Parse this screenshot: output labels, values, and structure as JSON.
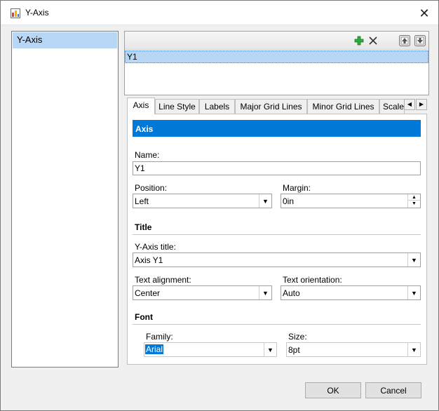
{
  "window": {
    "title": "Y-Axis",
    "close_glyph": "✕"
  },
  "nav": {
    "items": [
      "Y-Axis"
    ]
  },
  "series_list": {
    "items": [
      "Y1"
    ],
    "toolbar": [
      "add-icon",
      "delete-icon",
      "move-up-icon",
      "move-down-icon"
    ]
  },
  "tabs": [
    "Axis",
    "Line Style",
    "Labels",
    "Major Grid Lines",
    "Minor Grid Lines",
    "Scale"
  ],
  "tab_scroll": {
    "left": "◀",
    "right": "▶"
  },
  "axis_panel": {
    "header": "Axis",
    "name_label": "Name:",
    "name_value": "Y1",
    "position_label": "Position:",
    "position_value": "Left",
    "margin_label": "Margin:",
    "margin_value": "0in",
    "title_group": "Title",
    "axis_title_label": "Y-Axis title:",
    "axis_title_value": "Axis Y1",
    "text_alignment_label": "Text alignment:",
    "text_alignment_value": "Center",
    "text_orientation_label": "Text orientation:",
    "text_orientation_value": "Auto",
    "font_group": "Font",
    "family_label": "Family:",
    "family_value": "Arial",
    "size_label": "Size:",
    "size_value": "8pt"
  },
  "glyphs": {
    "dropdown": "▼",
    "spin_up": "▲",
    "spin_down": "▼"
  },
  "buttons": {
    "ok": "OK",
    "cancel": "Cancel"
  },
  "colors": {
    "selection": "#0078d7",
    "list_highlight": "#b7d7f5",
    "add_green": "#2eaa3a"
  }
}
